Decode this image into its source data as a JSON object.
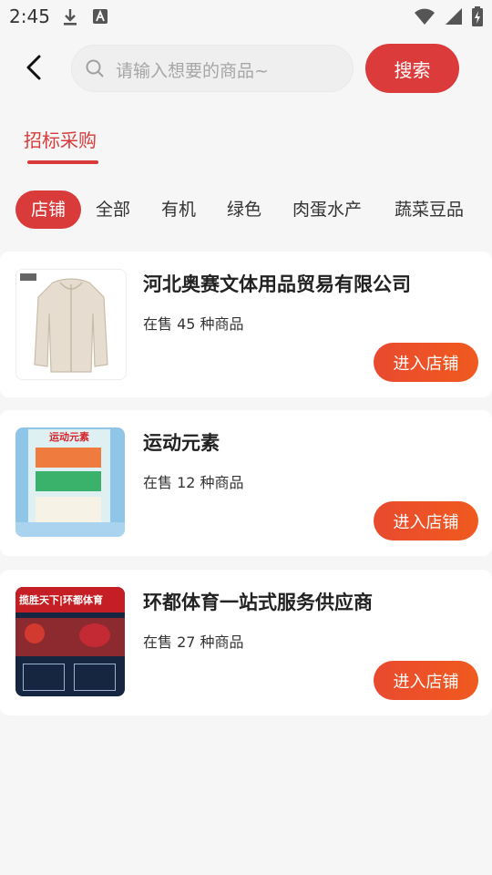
{
  "status": {
    "time": "2:45"
  },
  "search": {
    "placeholder": "请输入想要的商品~",
    "button_label": "搜索"
  },
  "tabs": {
    "active_label": "招标采购"
  },
  "categories": [
    {
      "label": "店铺",
      "active": true
    },
    {
      "label": "全部",
      "active": false
    },
    {
      "label": "有机",
      "active": false
    },
    {
      "label": "绿色",
      "active": false
    },
    {
      "label": "肉蛋水产",
      "active": false
    },
    {
      "label": "蔬菜豆品",
      "active": false
    }
  ],
  "shops": [
    {
      "name": "河北奥赛文体用品贸易有限公司",
      "count_text": "在售 45 种商品",
      "enter_label": "进入店铺",
      "thumb_text": ""
    },
    {
      "name": "运动元素",
      "count_text": "在售 12 种商品",
      "enter_label": "进入店铺",
      "thumb_text": "运动元素"
    },
    {
      "name": "环都体育一站式服务供应商",
      "count_text": "在售 27 种商品",
      "enter_label": "进入店铺",
      "thumb_text": "揽胜天下|环都体育"
    }
  ],
  "colors": {
    "accent": "#d93a3a",
    "enter_gradient_start": "#e84a2f",
    "enter_gradient_end": "#f05a1e"
  },
  "icons": [
    "download-icon",
    "text-icon",
    "wifi-icon",
    "signal-icon",
    "battery-icon",
    "back-icon",
    "search-icon"
  ]
}
